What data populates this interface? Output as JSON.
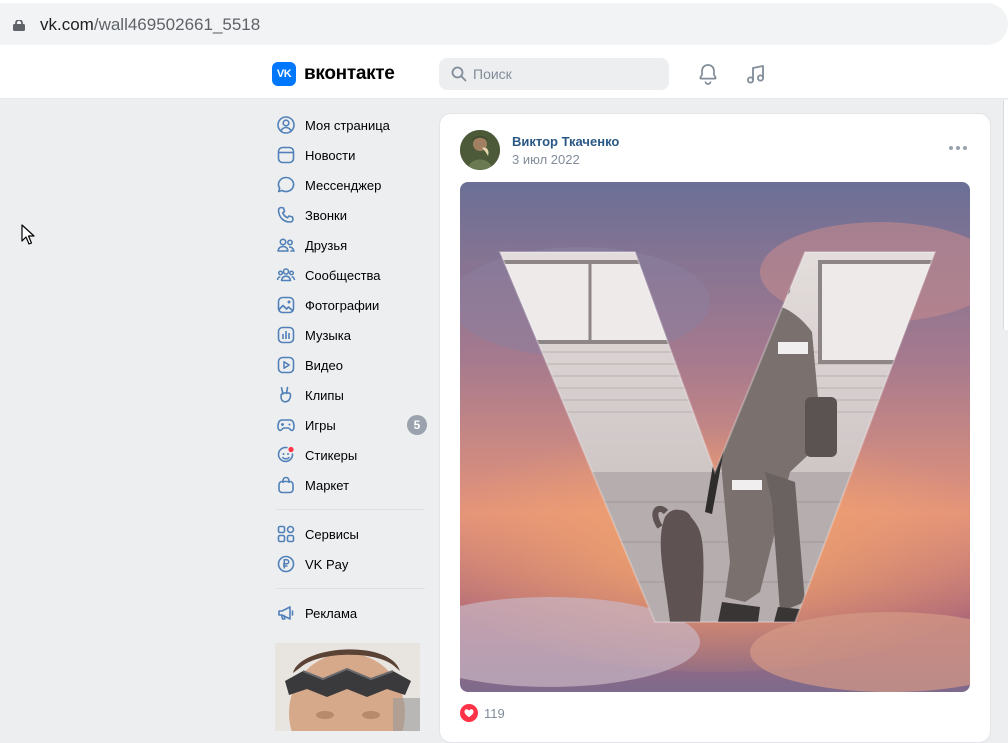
{
  "browser": {
    "url_domain": "vk.com",
    "url_path": "/wall469502661_5518"
  },
  "header": {
    "logo_mark": "VK",
    "logo_text": "вконтакте",
    "search_placeholder": "Поиск"
  },
  "sidebar": {
    "items": [
      {
        "label": "Моя страница",
        "icon": "user-circle-icon"
      },
      {
        "label": "Новости",
        "icon": "news-icon"
      },
      {
        "label": "Мессенджер",
        "icon": "message-icon"
      },
      {
        "label": "Звонки",
        "icon": "phone-icon"
      },
      {
        "label": "Друзья",
        "icon": "friends-icon"
      },
      {
        "label": "Сообщества",
        "icon": "communities-icon"
      },
      {
        "label": "Фотографии",
        "icon": "photo-icon"
      },
      {
        "label": "Музыка",
        "icon": "music-icon"
      },
      {
        "label": "Видео",
        "icon": "video-icon"
      },
      {
        "label": "Клипы",
        "icon": "clips-icon"
      },
      {
        "label": "Игры",
        "icon": "gamepad-icon",
        "badge": "5"
      },
      {
        "label": "Стикеры",
        "icon": "sticker-icon"
      },
      {
        "label": "Маркет",
        "icon": "market-bag-icon"
      }
    ],
    "services": [
      {
        "label": "Сервисы",
        "icon": "services-grid-icon"
      },
      {
        "label": "VK Pay",
        "icon": "vkpay-icon"
      }
    ],
    "ads": [
      {
        "label": "Реклама",
        "icon": "megaphone-icon"
      }
    ]
  },
  "post": {
    "author": "Виктор Ткаченко",
    "date": "3 июл 2022",
    "likes": "119"
  },
  "colors": {
    "accent": "#0077ff",
    "link": "#2a5885",
    "icon": "#5181b8",
    "like": "#ff3347"
  }
}
